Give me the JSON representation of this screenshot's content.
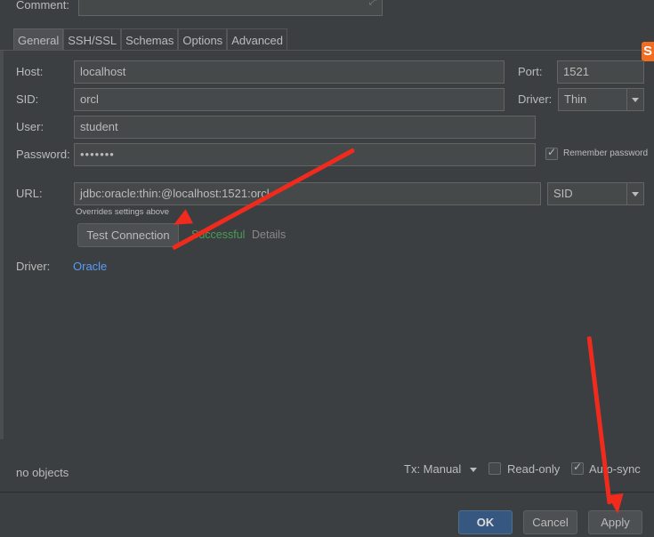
{
  "comment": {
    "label": "Comment:"
  },
  "tabs": [
    "General",
    "SSH/SSL",
    "Schemas",
    "Options",
    "Advanced"
  ],
  "form": {
    "host_label": "Host:",
    "host_value": "localhost",
    "port_label": "Port:",
    "port_value": "1521",
    "sid_label": "SID:",
    "sid_value": "orcl",
    "driver_label": "Driver:",
    "driver_value": "Thin",
    "user_label": "User:",
    "user_value": "student",
    "password_label": "Password:",
    "password_value": "•••••••",
    "remember_label": "Remember password",
    "url_label": "URL:",
    "url_value": "jdbc:oracle:thin:@localhost:1521:orcl",
    "url_type_value": "SID",
    "overrides_note": "Overrides settings above",
    "test_connection_label": "Test Connection",
    "status_text": "Successful",
    "details_link": "Details",
    "driver_link_label": "Driver:",
    "driver_link_value": "Oracle"
  },
  "footer": {
    "objects_text": "no objects",
    "tx_label": "Tx: Manual",
    "readonly_label": "Read-only",
    "autosync_label": "Auto-sync"
  },
  "buttons": {
    "ok": "OK",
    "cancel": "Cancel",
    "apply": "Apply"
  },
  "colors": {
    "success": "#499c54",
    "link": "#589df6",
    "annotation": "#f02b1d"
  }
}
